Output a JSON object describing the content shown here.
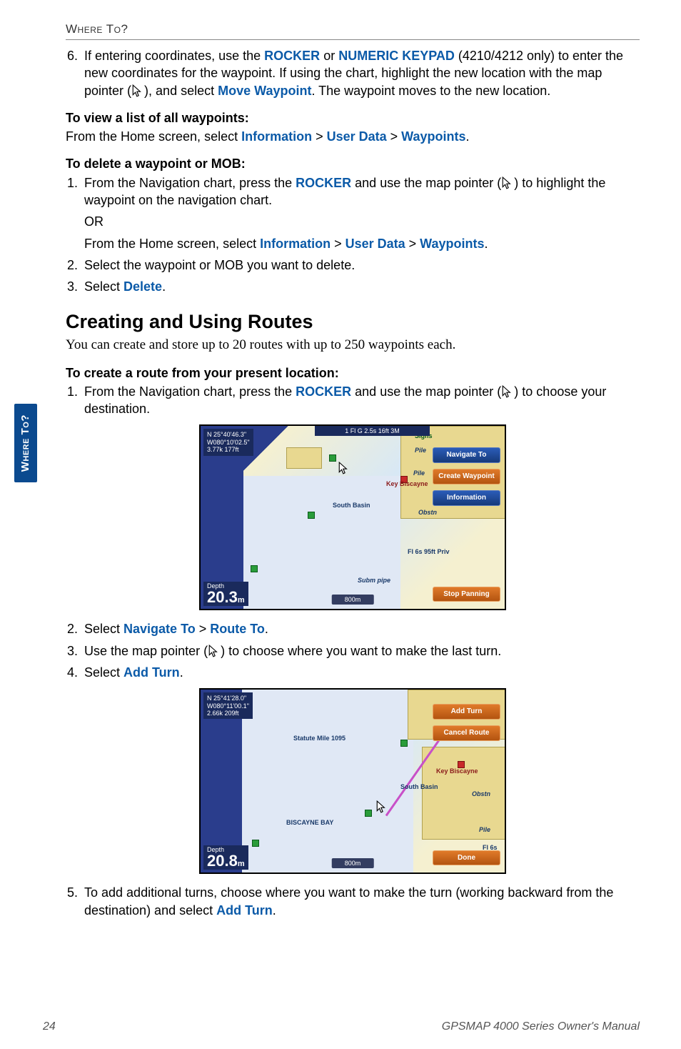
{
  "header": {
    "section_title": "Where To?"
  },
  "side_tab": "Where To?",
  "step6": {
    "num": "6.",
    "pre": "If entering coordinates, use the ",
    "rocker": "ROCKER",
    "mid1": " or ",
    "keypad": "NUMERIC KEYPAD",
    "mid2": " (4210/4212 only) to enter the new coordinates for the waypoint. If using the chart, highlight the new location with the map pointer (",
    "mid3": "), and select ",
    "move": "Move Waypoint",
    "end": ". The waypoint moves to the new location."
  },
  "view_list": {
    "heading": "To view a list of all waypoints:",
    "pre": "From the Home screen, select ",
    "info": "Information",
    "gt1": " > ",
    "ud": "User Data",
    "gt2": " > ",
    "wp": "Waypoints",
    "end": "."
  },
  "delete": {
    "heading": "To delete a waypoint or MOB:",
    "s1num": "1.",
    "s1pre": "From the Navigation chart, press the ",
    "s1rocker": "ROCKER",
    "s1mid": " and use the map pointer (",
    "s1end": ") to highlight the waypoint on the navigation chart.",
    "or": "OR",
    "s1bpre": "From the Home screen, select ",
    "s1binfo": "Information",
    "s1bgt1": " > ",
    "s1bud": "User Data",
    "s1bgt2": " > ",
    "s1bwp": "Waypoints",
    "s1bend": ".",
    "s2num": "2.",
    "s2": "Select the waypoint or MOB you want to delete.",
    "s3num": "3.",
    "s3pre": "Select ",
    "s3del": "Delete",
    "s3end": "."
  },
  "routes": {
    "heading": "Creating and Using Routes",
    "intro": "You can create and store up to 20 routes with up to 250 waypoints each.",
    "create_heading": "To create a route from your present location:",
    "s1num": "1.",
    "s1pre": "From the Navigation chart, press the ",
    "s1rocker": "ROCKER",
    "s1mid": " and use the map pointer (",
    "s1end": ") to choose your destination.",
    "s2num": "2.",
    "s2pre": "Select ",
    "s2nav": "Navigate To",
    "s2gt": " > ",
    "s2route": "Route To",
    "s2end": ".",
    "s3num": "3.",
    "s3pre": "Use the map pointer (",
    "s3end": ") to choose where you want to make the last turn.",
    "s4num": "4.",
    "s4pre": "Select ",
    "s4add": "Add Turn",
    "s4end": ".",
    "s5num": "5.",
    "s5pre": "To add additional turns, choose where you want to make the turn (working backward from the destination) and select ",
    "s5add": "Add Turn",
    "s5end": "."
  },
  "screenshot1": {
    "coord_line1": "N  25°40'46.3\"",
    "coord_line2": "W080°10'02.5\"",
    "coord_line3": "3.77k   177ft",
    "banner": "1 Fl G 2.5s 16ft 3M",
    "btn_nav": "Navigate To",
    "btn_create": "Create Waypoint",
    "btn_info": "Information",
    "btn_stop": "Stop Panning",
    "depth_label": "Depth",
    "depth_value": "20.3",
    "depth_unit": "m",
    "scale": "800m",
    "labels": {
      "pile1": "Pile",
      "pile2": "Pile",
      "keyb": "Key Biscayne",
      "sb": "South Basin",
      "obst": "Obstn",
      "fl": "Fl 6s 95ft Priv",
      "subm": "Subm pipe",
      "signs": "Signs"
    }
  },
  "screenshot2": {
    "coord_line1": "N  25°41'28.0\"",
    "coord_line2": "W080°11'00.1\"",
    "coord_line3": "2.66k   209ft",
    "btn_add": "Add Turn",
    "btn_cancel": "Cancel Route",
    "btn_done": "Done",
    "depth_label": "Depth",
    "depth_value": "20.8",
    "depth_unit": "m",
    "scale": "800m",
    "labels": {
      "bb": "BISCAYNE BAY",
      "sm": "Statute Mile 1095",
      "sb": "South Basin",
      "keyb": "Key Biscayne",
      "obst": "Obstn",
      "pile": "Pile",
      "fl": "Fl 6s"
    }
  },
  "footer": {
    "page": "24",
    "manual": "GPSMAP 4000 Series Owner's Manual"
  }
}
